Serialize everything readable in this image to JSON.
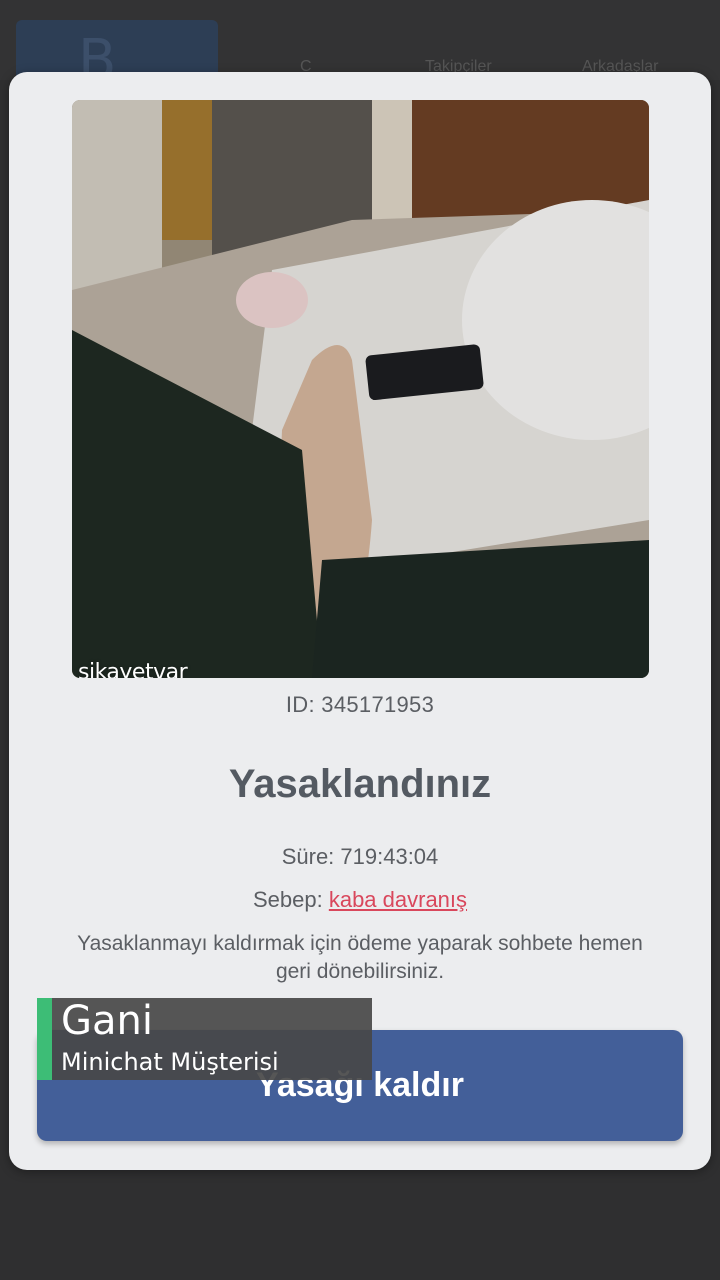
{
  "background_app": {
    "logo_letter": "B",
    "tabs": [
      "C",
      "Takipçiler",
      "Arkadaşlar"
    ]
  },
  "dialog": {
    "photo_watermark": "şikayetvar",
    "id_text": "ID: 345171953",
    "title": "Yasaklandınız",
    "duration_text": "Süre: 719:43:04",
    "reason_label": "Sebep:",
    "reason_value": "kaba davranış",
    "info_text": "Yasaklanmayı kaldırmak için ödeme yaparak sohbete hemen geri dönebilirsiniz.",
    "unban_button_label": "Yasağı kaldır"
  },
  "caption": {
    "name": "Gani",
    "role": "Minichat Müşterisi"
  },
  "colors": {
    "button": "#435f99",
    "reason": "#d9475c",
    "caption_accent": "#3dbd76"
  }
}
